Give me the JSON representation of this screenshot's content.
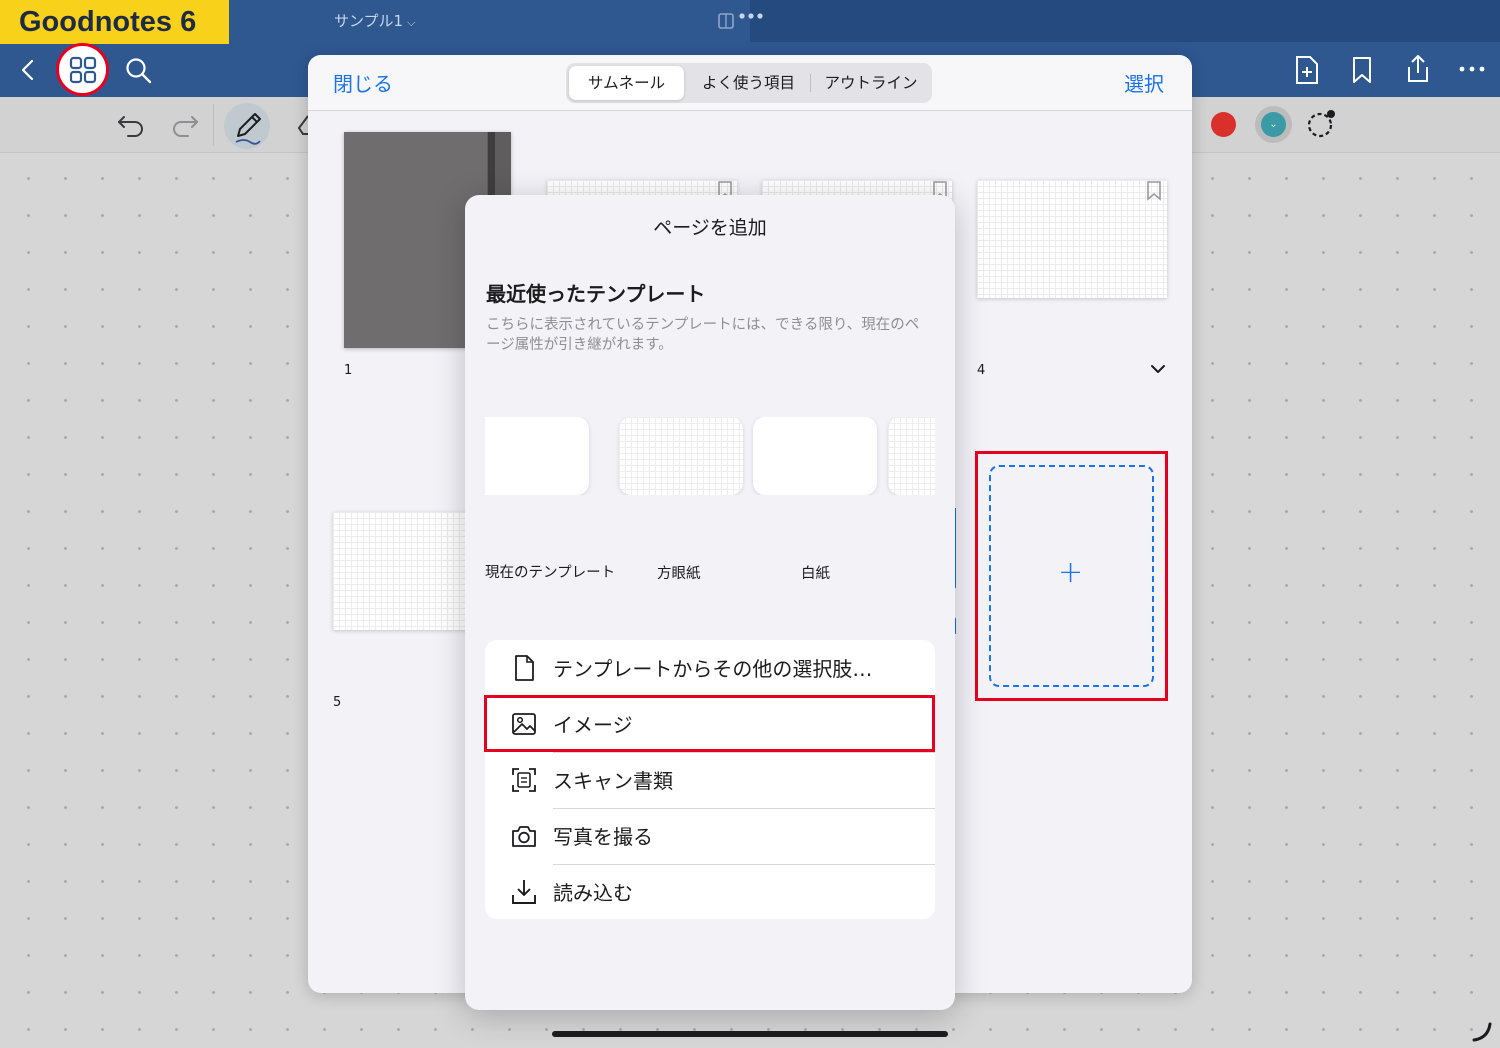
{
  "app": {
    "brand": "Goodnotes 6",
    "document_title": "サンプル1",
    "title_chevron": "⌵"
  },
  "sheet": {
    "close_label": "閉じる",
    "select_label": "選択",
    "tabs": [
      {
        "label": "サムネール",
        "active": true
      },
      {
        "label": "よく使う項目",
        "active": false
      },
      {
        "label": "アウトライン",
        "active": false
      }
    ],
    "page_numbers": [
      "1",
      "4",
      "5"
    ],
    "add_page_symbol": "+"
  },
  "popover": {
    "title": "ページを追加",
    "recent_heading": "最近使ったテンプレート",
    "recent_description": "こちらに表示されているテンプレートには、できる限り、現在のページ属性が引き継がれます。",
    "templates": [
      {
        "label": "現在のテンプレート"
      },
      {
        "label": "方眼紙"
      },
      {
        "label": "白紙"
      }
    ],
    "menu": [
      {
        "label": "テンプレートからその他の選択肢…",
        "icon": "document-icon"
      },
      {
        "label": "イメージ",
        "icon": "image-icon"
      },
      {
        "label": "スキャン書類",
        "icon": "scan-icon"
      },
      {
        "label": "写真を撮る",
        "icon": "camera-icon"
      },
      {
        "label": "読み込む",
        "icon": "import-icon"
      }
    ]
  },
  "colors": {
    "nav_background": "#2f5891",
    "brand_badge": "#f7d11a",
    "accent_blue": "#1a73e8",
    "highlight_red": "#e60020",
    "pen_red": "#d9302c",
    "pen_teal": "#3a9aa6"
  }
}
